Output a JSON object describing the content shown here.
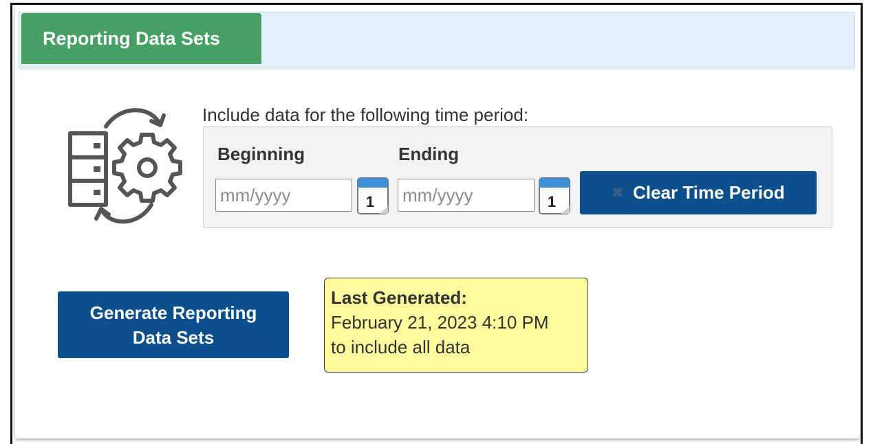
{
  "tab": {
    "label": "Reporting Data Sets"
  },
  "instruction": "Include data for the following time period:",
  "time_period": {
    "beginning_label": "Beginning",
    "ending_label": "Ending",
    "beginning": {
      "value": "",
      "placeholder": "mm/yyyy"
    },
    "ending": {
      "value": "",
      "placeholder": "mm/yyyy"
    },
    "calendar_day": "1",
    "clear_label": "Clear Time Period"
  },
  "generate_button": {
    "line1": "Generate Reporting",
    "line2": "Data Sets"
  },
  "last_generated": {
    "title": "Last Generated:",
    "datetime": "February 21, 2023 4:10 PM",
    "scope": "to include all data"
  },
  "icons": {
    "hero": "data-sets-gear-cycle-icon",
    "calendar": "calendar-icon",
    "clear": "close-icon"
  },
  "colors": {
    "tab_green": "#46a063",
    "tabbar_bg": "#e3f0fb",
    "button_blue": "#0b4f8c",
    "note_yellow": "#fdfb9d",
    "datebox_bg": "#f2f2f2"
  }
}
